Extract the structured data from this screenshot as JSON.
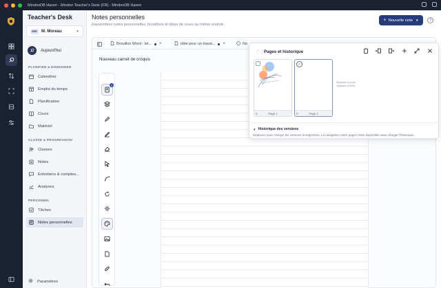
{
  "window": {
    "title": "MindooDB Haven - Mindoo Teacher's Desk (FR) - MindooDB Haven"
  },
  "colors": {
    "accent": "#263b7a",
    "rail_bg": "#1a2131",
    "sidebar_bg": "#f3f5f8"
  },
  "brand": {
    "name": "Teacher's Desk"
  },
  "user": {
    "initials": "MM",
    "name": "M. Moreau"
  },
  "today": {
    "label": "Aujourd'hui"
  },
  "sections": {
    "planning": "PLANIFIER & ENSEIGNER",
    "class": "CLASSE & PROGRESSION",
    "personal": "PERSONNEL"
  },
  "nav": {
    "planning": [
      "Calendrier",
      "Emploi du temps",
      "Planification",
      "Cours",
      "Matériel"
    ],
    "class": [
      "Classes",
      "Notes",
      "Entretiens & comptes...",
      "Analyses"
    ],
    "personal": [
      "Tâches",
      "Notes personnelles"
    ]
  },
  "settings": {
    "label": "Paramètres"
  },
  "main": {
    "title": "Notes personnelles",
    "subtitle": "Rassemblez notes personnelles, brouillons et idées de cours au même endroit.",
    "new_button": "Nouvelle note"
  },
  "tabs": [
    "Brouillon Word : let...",
    "Idée pour un travai...",
    "No"
  ],
  "document": {
    "name": "Nouveau carnet de croquis"
  },
  "tool_badge": "2",
  "pages_panel": {
    "title": "Pages et historique",
    "pages": [
      "Page 1",
      "Page 2"
    ],
    "page_nums": [
      "0",
      "0"
    ],
    "dropzone": "Déposez ici pour déplacer à la fin",
    "history_label": "Historique des versions",
    "history_desc": "Déplacez pour charger les versions enregistrées. La navigation entre pages reste disponible sans charger l'historique."
  }
}
